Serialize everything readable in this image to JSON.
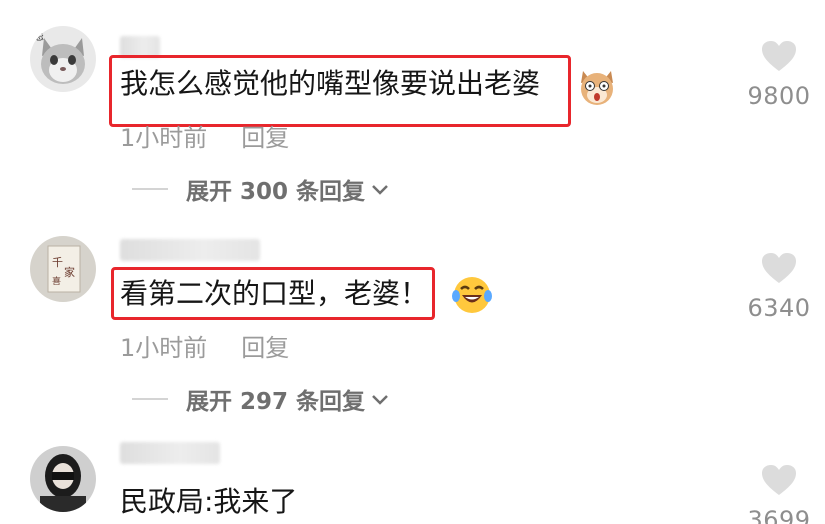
{
  "comments": [
    {
      "text": "我怎么感觉他的嘴型像要说出老婆",
      "emoji": "shocked-dog-emoji",
      "time": "1小时前",
      "reply_label": "回复",
      "expand_label": "展开 300 条回复",
      "likes": "9800"
    },
    {
      "text": "看第二次的口型，老婆！",
      "emoji": "laughing-tears-emoji",
      "time": "1小时前",
      "reply_label": "回复",
      "expand_label": "展开 297 条回复",
      "likes": "6340"
    },
    {
      "text": "民政局:我来了",
      "likes": "3699"
    }
  ],
  "colors": {
    "highlight": "#e8262c",
    "meta_gray": "#9b9b9b",
    "heart_gray": "#dcdcdc"
  }
}
